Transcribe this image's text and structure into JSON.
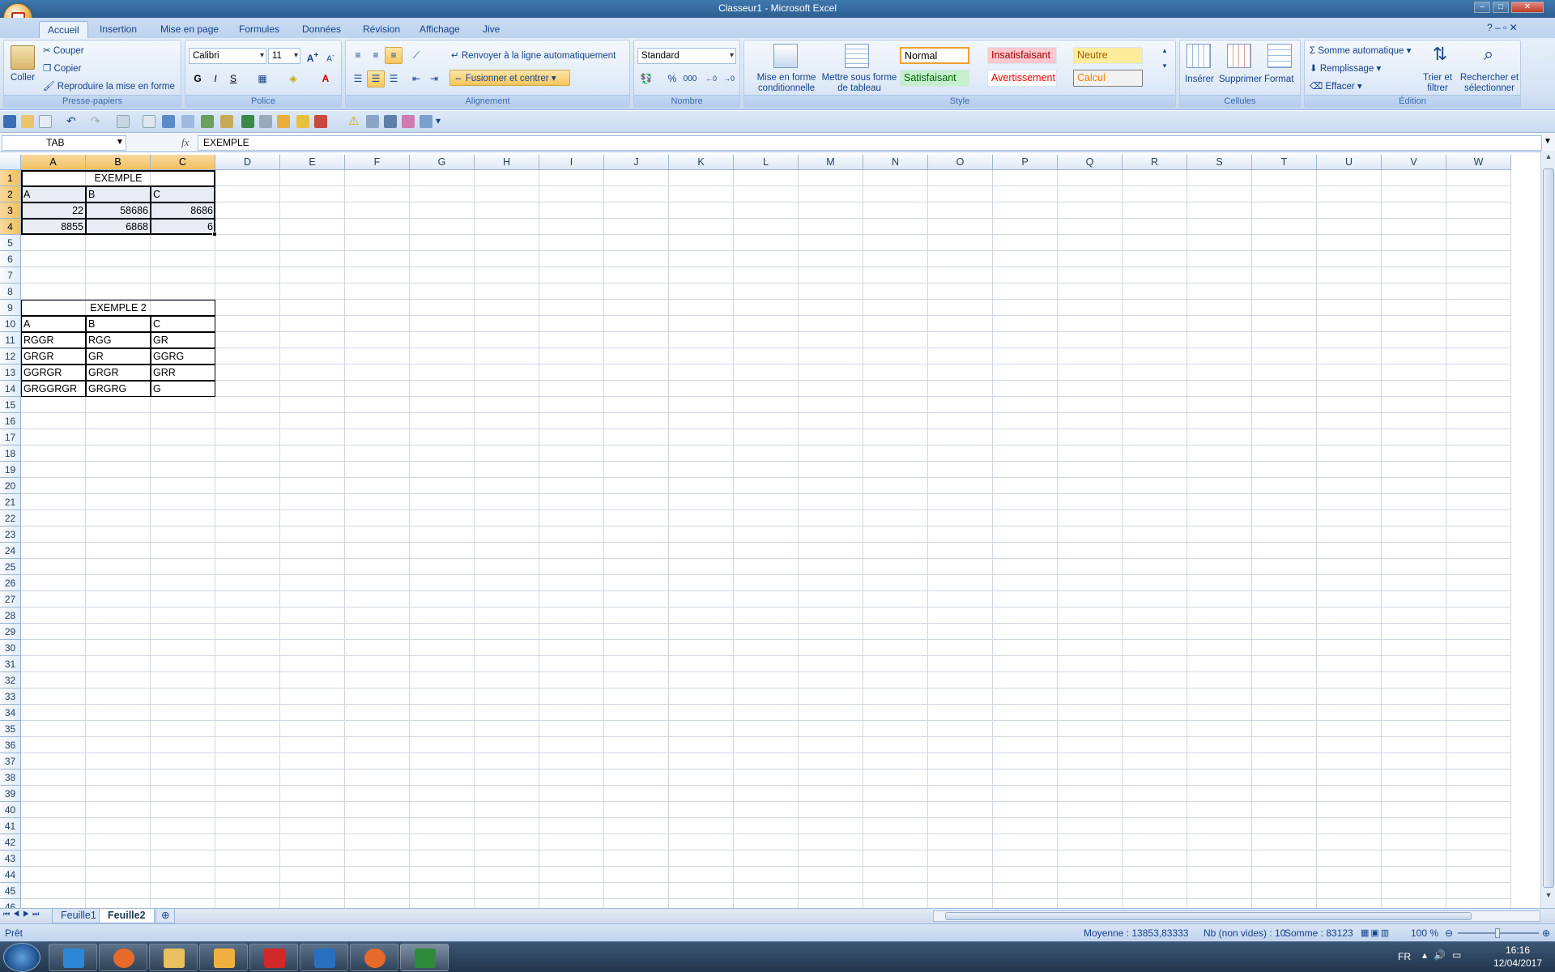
{
  "window": {
    "title": "Classeur1 - Microsoft Excel"
  },
  "tabs": [
    "Accueil",
    "Insertion",
    "Mise en page",
    "Formules",
    "Données",
    "Révision",
    "Affichage",
    "Jive"
  ],
  "active_tab": "Accueil",
  "ribbon": {
    "clipboard": {
      "paste": "Coller",
      "cut": "Couper",
      "copy": "Copier",
      "format_painter": "Reproduire la mise en forme",
      "label": "Presse-papiers"
    },
    "font": {
      "name": "Calibri",
      "size": "11",
      "label": "Police",
      "bold": "G",
      "italic": "I",
      "underline": "S"
    },
    "alignment": {
      "wrap": "Renvoyer à la ligne automatiquement",
      "merge": "Fusionner et centrer",
      "label": "Alignement"
    },
    "number": {
      "format": "Standard",
      "percent": "%",
      "thousands": "000",
      "label": "Nombre"
    },
    "style": {
      "conditional": "Mise en forme conditionnelle",
      "as_table": "Mettre sous forme de tableau",
      "cells": [
        {
          "name": "Normal",
          "color": "#000000",
          "bg": "#ffffff"
        },
        {
          "name": "Insatisfaisant",
          "color": "#9c0006",
          "bg": "#ffc7ce"
        },
        {
          "name": "Neutre",
          "color": "#9c6500",
          "bg": "#ffeb9c"
        },
        {
          "name": "Satisfaisant",
          "color": "#006100",
          "bg": "#c6efce"
        },
        {
          "name": "Avertissement",
          "color": "#ff0000",
          "bg": "#ffffff"
        },
        {
          "name": "Calcul",
          "color": "#fa7d00",
          "bg": "#f2f2f2"
        }
      ],
      "label": "Style"
    },
    "cells": {
      "insert": "Insérer",
      "delete": "Supprimer",
      "format": "Format",
      "label": "Cellules"
    },
    "editing": {
      "autosum": "Somme automatique",
      "fill": "Remplissage",
      "clear": "Effacer",
      "sort_filter": "Trier et filtrer",
      "find_select": "Rechercher et sélectionner",
      "label": "Édition"
    }
  },
  "formula_bar": {
    "name_box": "TAB",
    "fx": "fx",
    "content": "EXEMPLE"
  },
  "columns": [
    "A",
    "B",
    "C",
    "D",
    "E",
    "F",
    "G",
    "H",
    "I",
    "J",
    "K",
    "L",
    "M",
    "N",
    "O",
    "P",
    "Q",
    "R",
    "S",
    "T",
    "U",
    "V",
    "W"
  ],
  "rows_visible": 46,
  "table1": {
    "title": "EXEMPLE",
    "headers": [
      "A",
      "B",
      "C"
    ],
    "rows": [
      [
        "22",
        "58686",
        "8686"
      ],
      [
        "8855",
        "6868",
        "6"
      ]
    ]
  },
  "table2": {
    "title": "EXEMPLE 2",
    "headers": [
      "A",
      "B",
      "C"
    ],
    "rows": [
      [
        "RGGR",
        "RGG",
        "GR"
      ],
      [
        "GRGR",
        "GR",
        "GGRG"
      ],
      [
        "GGRGR",
        "GRGR",
        "GRR"
      ],
      [
        "GRGGRGR",
        "GRGRG",
        "G"
      ]
    ]
  },
  "sheets": [
    "Feuille1",
    "Feuille2"
  ],
  "active_sheet": "Feuille2",
  "status": {
    "mode": "Prêt",
    "average": "Moyenne : 13853,83333",
    "count": "Nb (non vides) : 10",
    "sum": "Somme : 83123",
    "zoom": "100 %"
  },
  "taskbar": {
    "lang": "FR",
    "time": "16:16",
    "date": "12/04/2017"
  }
}
